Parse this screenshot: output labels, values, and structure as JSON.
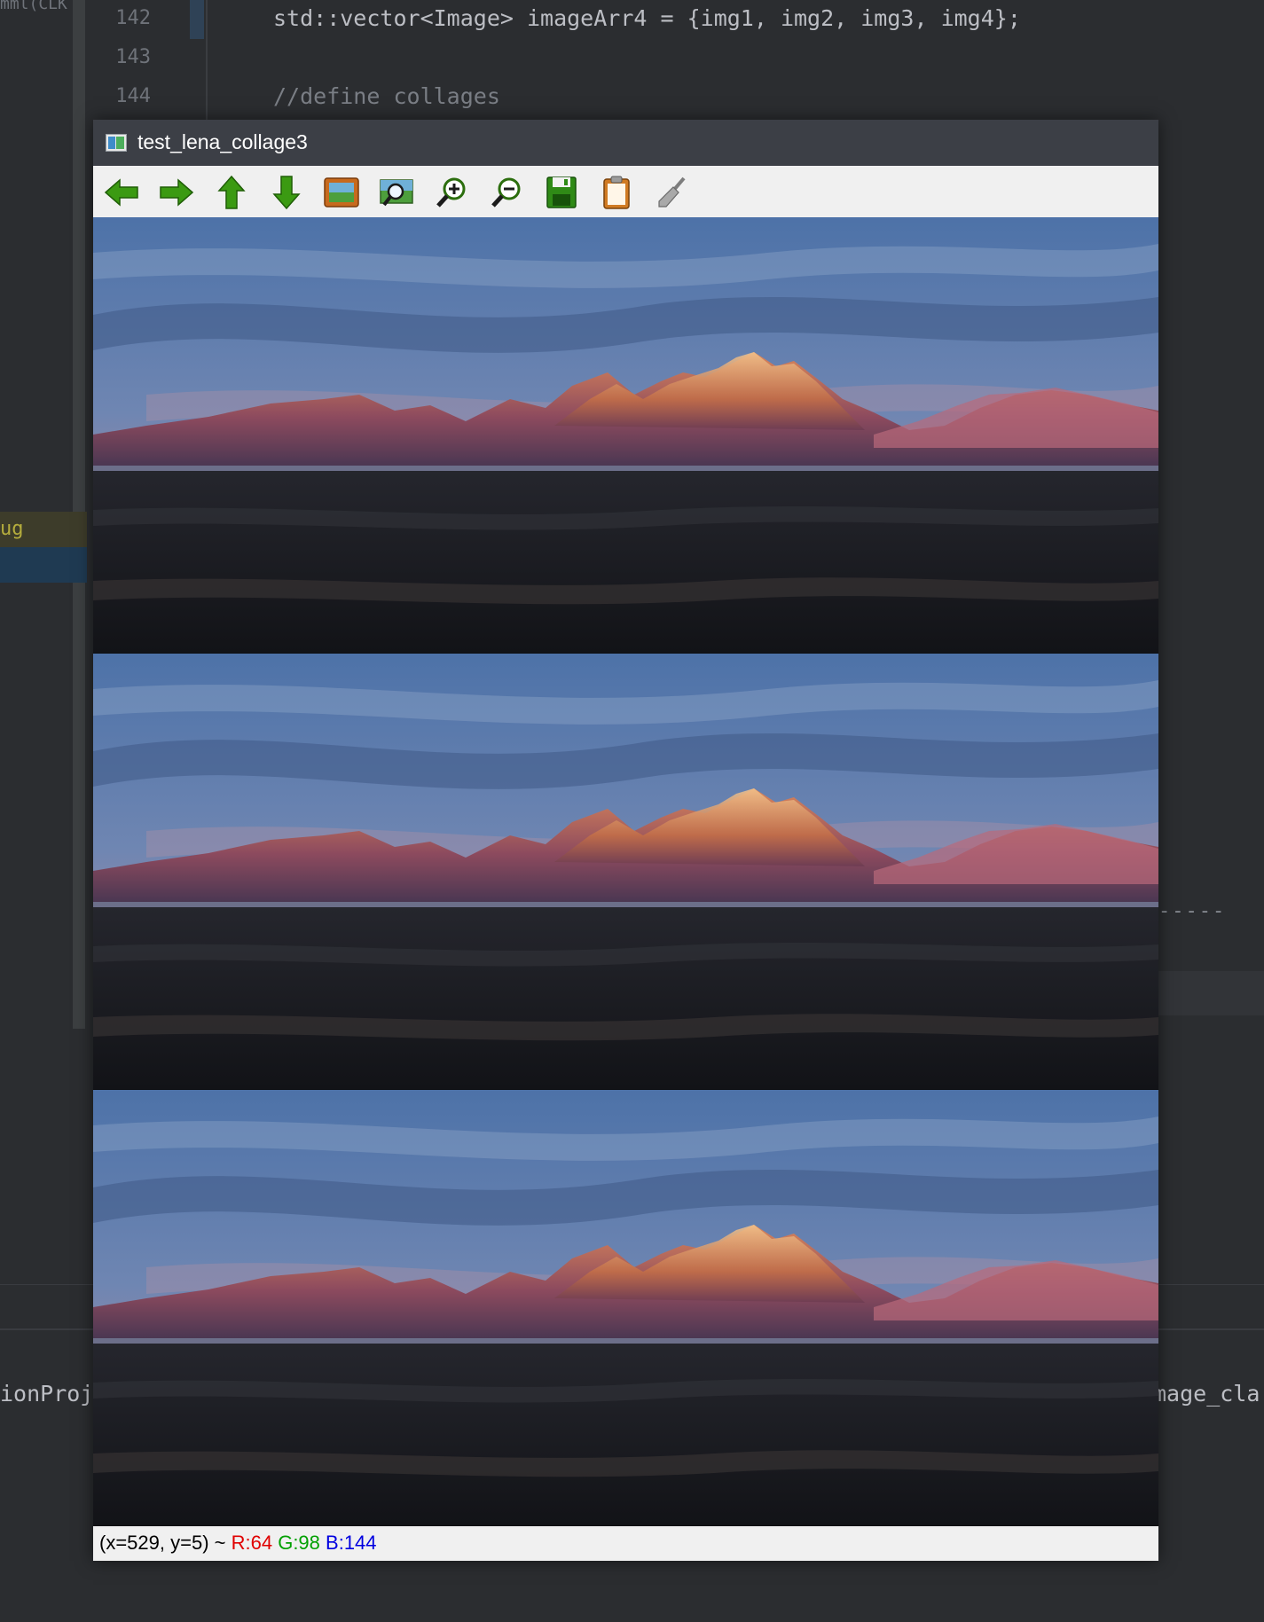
{
  "ide": {
    "top_fragment": "mml(CLK",
    "debug_label": "ug",
    "lines": [
      {
        "num": "142",
        "code": "std::vector<Image> imageArr4 = {img1, img2, img3, img4};"
      },
      {
        "num": "143",
        "code": ""
      },
      {
        "num": "144",
        "code": "//define collages"
      }
    ],
    "dashes": "-----",
    "bottom_left": "ionProj",
    "bottom_right": "mage_cla"
  },
  "window": {
    "title": "test_lena_collage3",
    "toolbar": [
      {
        "name": "pan-left-button",
        "icon": "arrow-left-icon"
      },
      {
        "name": "pan-right-button",
        "icon": "arrow-right-icon"
      },
      {
        "name": "pan-up-button",
        "icon": "arrow-up-icon"
      },
      {
        "name": "pan-down-button",
        "icon": "arrow-down-icon"
      },
      {
        "name": "zoom-fit-button",
        "icon": "image-icon"
      },
      {
        "name": "zoom-original-button",
        "icon": "zoom-image-icon"
      },
      {
        "name": "zoom-in-button",
        "icon": "zoom-in-icon"
      },
      {
        "name": "zoom-out-button",
        "icon": "zoom-out-icon"
      },
      {
        "name": "save-button",
        "icon": "floppy-disk-icon"
      },
      {
        "name": "properties-button",
        "icon": "clipboard-icon"
      },
      {
        "name": "brush-button",
        "icon": "brush-icon"
      }
    ],
    "status": {
      "coords": "(x=529, y=5) ~ ",
      "r": "R:64",
      "g": "G:98",
      "b": "B:144"
    },
    "colors": {
      "arrow_green": "#2e8b00",
      "sky_blue": "#5a83b5",
      "alpenglow": "#c8784e",
      "ground_dark": "#16171b"
    }
  }
}
